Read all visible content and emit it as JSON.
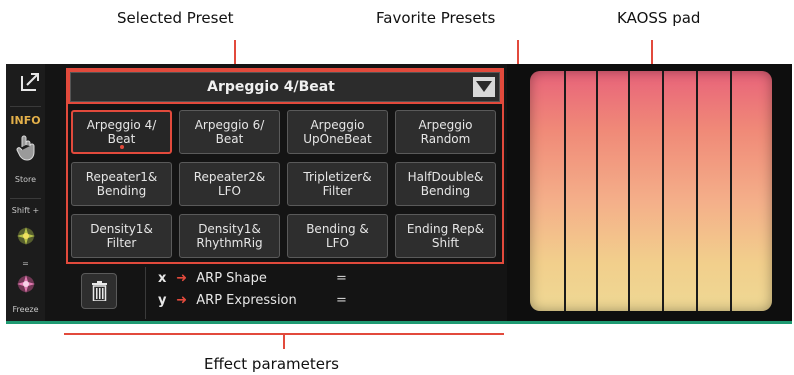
{
  "callouts": {
    "selected_preset": "Selected Preset",
    "favorite_presets": "Favorite Presets",
    "kaoss_pad": "KAOSS pad",
    "effect_parameters": "Effect parameters"
  },
  "sidebar": {
    "info": "INFO",
    "store": "Store",
    "shift": "Shift +",
    "equals": "=",
    "freeze": "Freeze"
  },
  "selected_preset": {
    "name": "Arpeggio 4/Beat"
  },
  "favorites": [
    {
      "label": "Arpeggio 4/\nBeat"
    },
    {
      "label": "Arpeggio 6/\nBeat"
    },
    {
      "label": "Arpeggio\nUpOneBeat"
    },
    {
      "label": "Arpeggio\nRandom"
    },
    {
      "label": "Repeater1&\nBending"
    },
    {
      "label": "Repeater2&\nLFO"
    },
    {
      "label": "Tripletizer&\nFilter"
    },
    {
      "label": "HalfDouble&\nBending"
    },
    {
      "label": "Density1&\nFilter"
    },
    {
      "label": "Density1&\nRhythmRig"
    },
    {
      "label": "Bending &\nLFO"
    },
    {
      "label": "Ending Rep&\nShift"
    }
  ],
  "effect_params": [
    {
      "axis": "x",
      "name": "ARP Shape",
      "value": "="
    },
    {
      "axis": "y",
      "name": "ARP Expression",
      "value": "="
    }
  ],
  "colors": {
    "accent": "#e24a3c",
    "info": "#e3b04a",
    "status_line": "#1f9a72"
  }
}
